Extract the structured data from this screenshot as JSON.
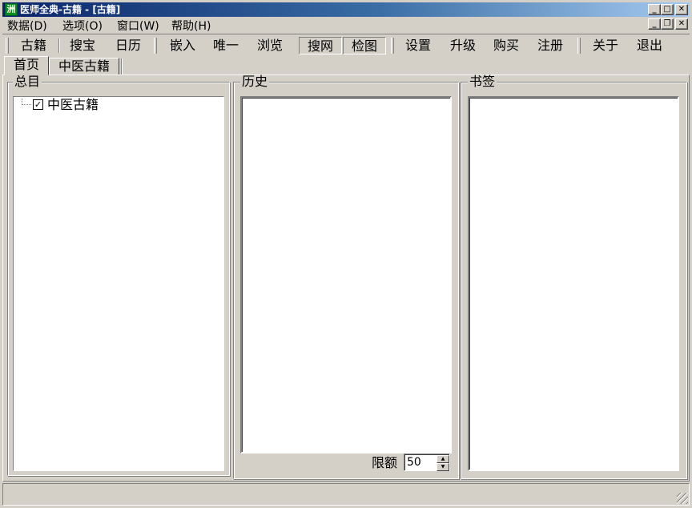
{
  "window": {
    "title": "医师全典-古籍 - [古籍]",
    "app_icon_glyph": "洲"
  },
  "menu": {
    "items": [
      "数据(D)",
      "选项(O)",
      "窗口(W)",
      "帮助(H)"
    ]
  },
  "toolbar": {
    "buttons": [
      "古籍",
      "搜宝",
      "日历",
      "嵌入",
      "唯一",
      "浏览",
      "搜网",
      "检图",
      "设置",
      "升级",
      "购买",
      "注册",
      "关于",
      "退出"
    ]
  },
  "tabs": [
    "首页",
    "中医古籍"
  ],
  "groups": {
    "catalog": {
      "title": "总目",
      "tree": [
        {
          "label": "中医古籍",
          "checked": true
        }
      ]
    },
    "history": {
      "title": "历史",
      "limit_label": "限额",
      "limit_value": "50"
    },
    "bookmarks": {
      "title": "书签"
    }
  },
  "glyphs": {
    "minimize": "_",
    "maximize": "□",
    "restore": "❐",
    "close": "✕",
    "check": "✓",
    "spin_up": "▲",
    "spin_down": "▼"
  }
}
